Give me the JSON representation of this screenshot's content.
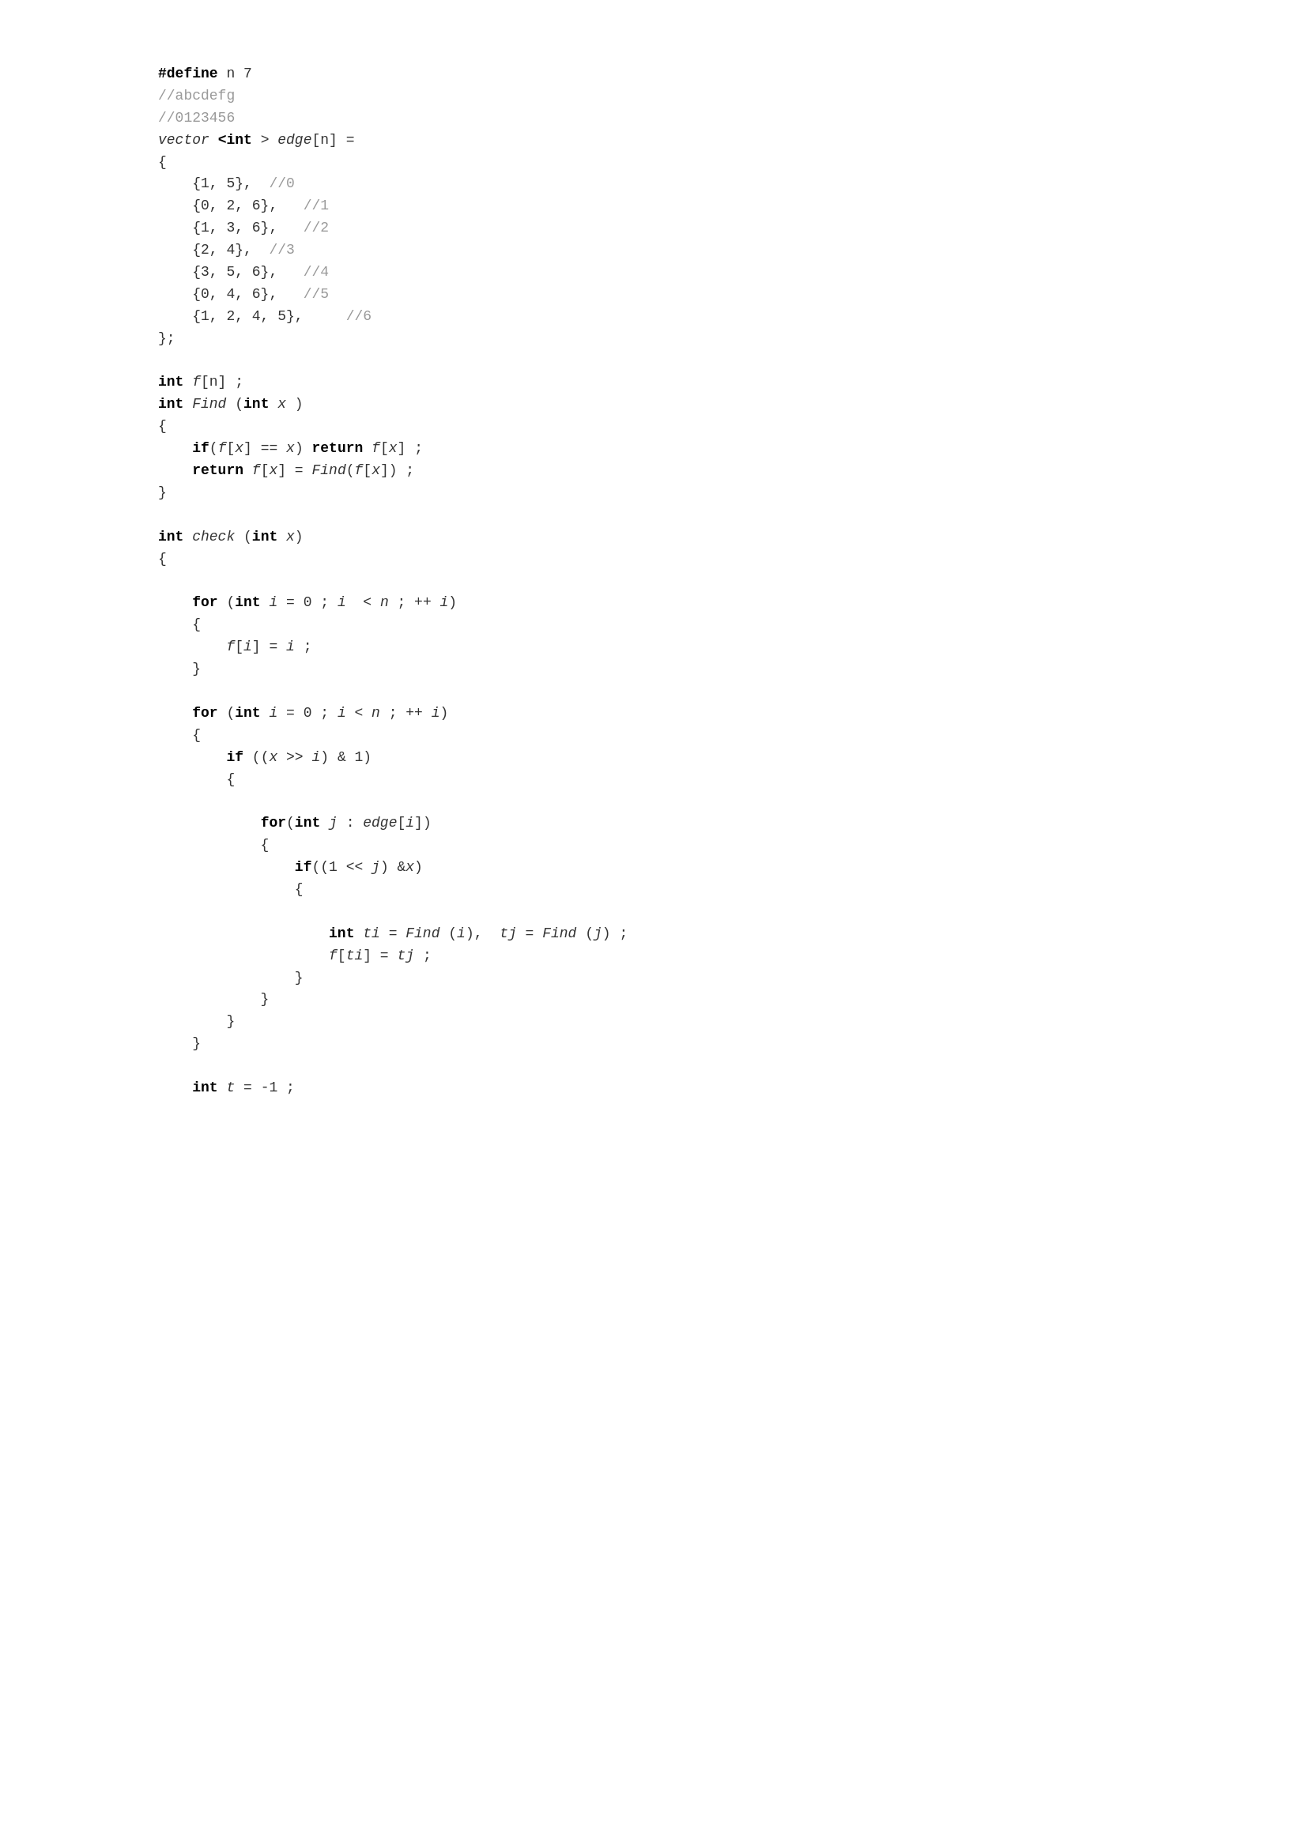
{
  "code": {
    "lines": [
      {
        "id": 1,
        "text": "#define n 7",
        "type": "define"
      },
      {
        "id": 2,
        "text": "//abcdefg",
        "type": "comment"
      },
      {
        "id": 3,
        "text": "//0123456",
        "type": "comment"
      },
      {
        "id": 4,
        "text": "vector <int > edge[n] =",
        "type": "mixed"
      },
      {
        "id": 5,
        "text": "{",
        "type": "normal"
      },
      {
        "id": 6,
        "text": "    {1, 5},  //0",
        "type": "normal"
      },
      {
        "id": 7,
        "text": "    {0, 2, 6},   //1",
        "type": "normal"
      },
      {
        "id": 8,
        "text": "    {1, 3, 6},   //2",
        "type": "normal"
      },
      {
        "id": 9,
        "text": "    {2, 4},  //3",
        "type": "normal"
      },
      {
        "id": 10,
        "text": "    {3, 5, 6},   //4",
        "type": "normal"
      },
      {
        "id": 11,
        "text": "    {0, 4, 6},   //5",
        "type": "normal"
      },
      {
        "id": 12,
        "text": "    {1, 2, 4, 5},     //6",
        "type": "normal"
      },
      {
        "id": 13,
        "text": "};",
        "type": "normal"
      },
      {
        "id": 14,
        "text": "",
        "type": "blank"
      },
      {
        "id": 15,
        "text": "int f[n] ;",
        "type": "kw-line"
      },
      {
        "id": 16,
        "text": "int Find (int x )",
        "type": "kw-line"
      },
      {
        "id": 17,
        "text": "{",
        "type": "normal"
      },
      {
        "id": 18,
        "text": "    if(f[x] == x) return f[x] ;",
        "type": "kw-line"
      },
      {
        "id": 19,
        "text": "    return f[x] = Find(f[x]) ;",
        "type": "kw-line"
      },
      {
        "id": 20,
        "text": "}",
        "type": "normal"
      },
      {
        "id": 21,
        "text": "",
        "type": "blank"
      },
      {
        "id": 22,
        "text": "int check (int x)",
        "type": "kw-line"
      },
      {
        "id": 23,
        "text": "{",
        "type": "normal"
      },
      {
        "id": 24,
        "text": "",
        "type": "blank"
      },
      {
        "id": 25,
        "text": "    for (int i = 0 ; i  < n ; ++ i)",
        "type": "kw-line"
      },
      {
        "id": 26,
        "text": "    {",
        "type": "normal"
      },
      {
        "id": 27,
        "text": "        f[i] = i ;",
        "type": "normal"
      },
      {
        "id": 28,
        "text": "    }",
        "type": "normal"
      },
      {
        "id": 29,
        "text": "",
        "type": "blank"
      },
      {
        "id": 30,
        "text": "    for (int i = 0 ; i < n ; ++ i)",
        "type": "kw-line"
      },
      {
        "id": 31,
        "text": "    {",
        "type": "normal"
      },
      {
        "id": 32,
        "text": "        if ((x >> i) & 1)",
        "type": "kw-line"
      },
      {
        "id": 33,
        "text": "        {",
        "type": "normal"
      },
      {
        "id": 34,
        "text": "",
        "type": "blank"
      },
      {
        "id": 35,
        "text": "            for(int j : edge[i])",
        "type": "kw-line"
      },
      {
        "id": 36,
        "text": "            {",
        "type": "normal"
      },
      {
        "id": 37,
        "text": "                if((1 << j) &x)",
        "type": "kw-line"
      },
      {
        "id": 38,
        "text": "                {",
        "type": "normal"
      },
      {
        "id": 39,
        "text": "",
        "type": "blank"
      },
      {
        "id": 40,
        "text": "                    int ti = Find (i),  tj = Find (j) ;",
        "type": "kw-line"
      },
      {
        "id": 41,
        "text": "                    f[ti] = tj ;",
        "type": "normal"
      },
      {
        "id": 42,
        "text": "                }",
        "type": "normal"
      },
      {
        "id": 43,
        "text": "            }",
        "type": "normal"
      },
      {
        "id": 44,
        "text": "        }",
        "type": "normal"
      },
      {
        "id": 45,
        "text": "    }",
        "type": "normal"
      },
      {
        "id": 46,
        "text": "",
        "type": "blank"
      },
      {
        "id": 47,
        "text": "    int t = -1 ;",
        "type": "kw-line"
      }
    ]
  }
}
